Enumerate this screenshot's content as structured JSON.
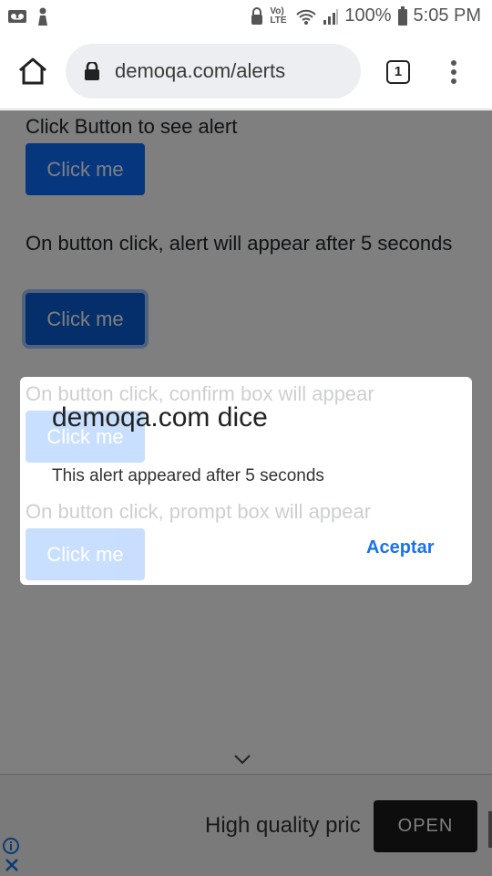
{
  "status_bar": {
    "battery": "100%",
    "time": "5:05 PM",
    "network": "Vo) LTE",
    "icons": [
      "voicemail-icon",
      "person-icon",
      "lock-icon",
      "lte-icon",
      "wifi-icon",
      "signal-icon",
      "battery-icon"
    ]
  },
  "browser": {
    "url": "demoqa.com/alerts",
    "tab_count": "1",
    "icons": [
      "home-icon",
      "lock-icon",
      "tabs-icon",
      "menu-icon"
    ]
  },
  "page": {
    "section1_label": "Click Button to see alert",
    "section1_button": "Click me",
    "section2_label": "On button click, alert will appear after 5 seconds",
    "section2_button": "Click me",
    "section3_label": "On button click, confirm box will appear",
    "section3_button": "Click me",
    "section4_label": "On button click, prompt box will appear",
    "section4_button": "Click me"
  },
  "dialog": {
    "title": "demoqa.com dice",
    "message": "This alert appeared after 5 seconds",
    "accept_label": "Aceptar"
  },
  "ad": {
    "text": "High quality pric",
    "open_label": "OPEN"
  },
  "colors": {
    "primary_button": "#0d6efd",
    "dialog_accent": "#1a73e8",
    "overlay": "rgba(0,0,0,0.5)"
  }
}
